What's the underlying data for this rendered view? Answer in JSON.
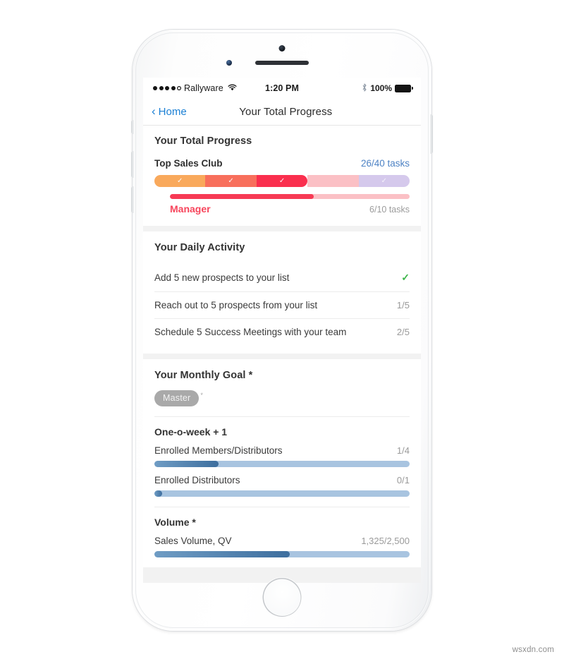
{
  "statusbar": {
    "carrier": "Rallyware",
    "signal_dots": 5,
    "signal_filled": 4,
    "wifi_icon": "wifi-icon",
    "time": "1:20 PM",
    "bluetooth_icon": "bluetooth-icon",
    "battery_percent": "100%"
  },
  "navbar": {
    "back_label": "Home",
    "back_icon": "chevron-left-icon",
    "title": "Your Total Progress"
  },
  "total_progress": {
    "title": "Your Total Progress",
    "club_label": "Top Sales Club",
    "club_count": "26/40 tasks",
    "count_color": "#4d82c4",
    "segments": [
      {
        "name": "segment-1",
        "color": "#f9a95c",
        "state": "complete",
        "check": "✓"
      },
      {
        "name": "segment-2",
        "color": "#f86f5c",
        "state": "complete",
        "check": "✓"
      },
      {
        "name": "segment-3",
        "color": "#fa2f4e",
        "state": "current",
        "check": "✓"
      },
      {
        "name": "segment-4",
        "color": "#fbc0c5",
        "state": "track",
        "check": ""
      },
      {
        "name": "segment-5",
        "color": "#d5c9ec",
        "state": "future",
        "check": "✓"
      }
    ],
    "rank_label": "Manager",
    "rank_color": "#f7455c",
    "rank_count": "6/10 tasks",
    "rank_percent": 60
  },
  "daily_activity": {
    "title": "Your Daily Activity",
    "items": [
      {
        "label": "Add 5 new prospects to your list",
        "value": "",
        "done": true,
        "check": "✓"
      },
      {
        "label": "Reach out to 5 prospects from your list",
        "value": "1/5",
        "done": false,
        "check": ""
      },
      {
        "label": "Schedule 5 Success Meetings with your team",
        "value": "2/5",
        "done": false,
        "check": ""
      }
    ],
    "check_color": "#3cb54a"
  },
  "monthly_goal": {
    "title": "Your Monthly Goal *",
    "badge": "Master",
    "badge_star": "*",
    "sections": [
      {
        "name": "one-o-week",
        "title": "One-o-week + 1",
        "metrics": [
          {
            "label": "Enrolled Members/Distributors",
            "value": "1/4",
            "percent": 25
          },
          {
            "label": "Enrolled Distributors",
            "value": "0/1",
            "percent": 3
          }
        ]
      },
      {
        "name": "volume",
        "title": "Volume *",
        "metrics": [
          {
            "label": "Sales Volume, QV",
            "value": "1,325/2,500",
            "percent": 53
          }
        ]
      }
    ]
  },
  "watermark": "wsxdn.com"
}
